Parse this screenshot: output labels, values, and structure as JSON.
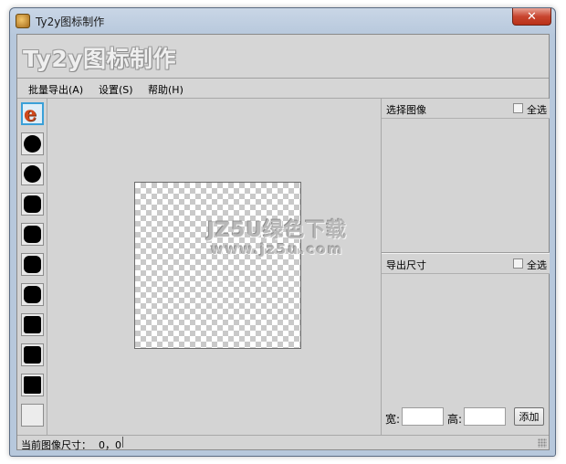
{
  "window": {
    "title": "Ty2y图标制作",
    "close_label": "✕"
  },
  "banner": {
    "title": "Ty2y图标制作"
  },
  "menu": {
    "items": [
      "批量导出(A)",
      "设置(S)",
      "帮助(H)"
    ]
  },
  "icon_strip": {
    "first_icon_glyph": "e",
    "items": [
      "ie-icon",
      "black-circle-icon",
      "black-circle-icon",
      "black-rounded-icon",
      "black-rounded-icon",
      "black-rounded-icon",
      "black-rounded-icon",
      "black-square-icon",
      "black-square-icon",
      "black-square-icon",
      "empty-slot"
    ]
  },
  "watermark": {
    "line1": "JZ5U绿色下载",
    "line2": "www.jz5u.com"
  },
  "select_panel": {
    "title": "选择图像",
    "select_all_label": "全选"
  },
  "export_panel": {
    "title": "导出尺寸",
    "select_all_label": "全选",
    "width_label": "宽:",
    "height_label": "高:",
    "width_value": "",
    "height_value": "",
    "add_label": "添加"
  },
  "status": {
    "label": "当前图像尺寸：",
    "value": "0，0"
  },
  "colors": {
    "selection_border": "#3aa0d8",
    "ie_icon": "#d0491c",
    "close_button": "#c8452f"
  }
}
